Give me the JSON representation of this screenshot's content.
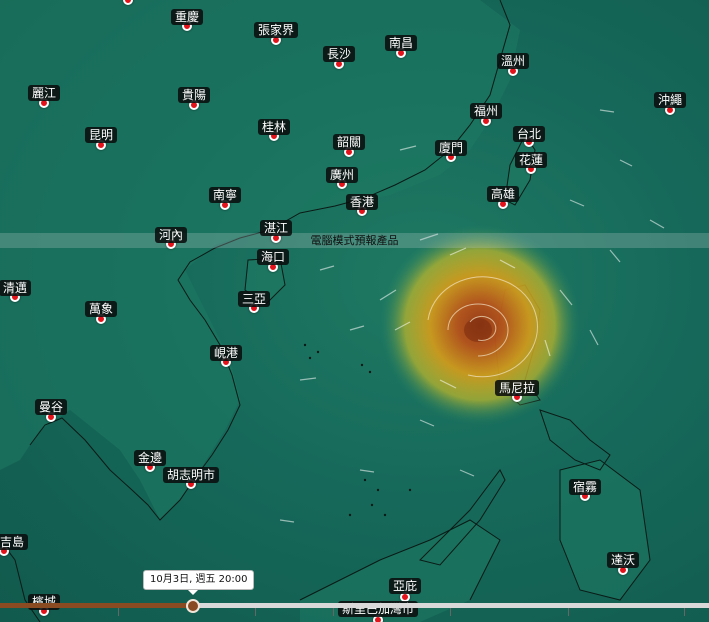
{
  "banner": "電腦模式預報產品",
  "timeline": {
    "time_label": "10月3日, 週五 20:00",
    "progress": 0.27
  },
  "colors": {
    "sea": "#16695a",
    "storm_core": "#b34a1a",
    "storm_outer": "#d6a51a",
    "marker": "#e3131b"
  },
  "cities": [
    {
      "id": "top-left",
      "name": ""
    },
    {
      "id": "chongqing",
      "name": "重慶"
    },
    {
      "id": "zhangjiajie",
      "name": "張家界"
    },
    {
      "id": "changsha",
      "name": "長沙"
    },
    {
      "id": "nanchang",
      "name": "南昌"
    },
    {
      "id": "wenzhou",
      "name": "溫州"
    },
    {
      "id": "lijiang",
      "name": "麗江"
    },
    {
      "id": "guiyang",
      "name": "貴陽"
    },
    {
      "id": "okinawa",
      "name": "沖繩"
    },
    {
      "id": "fuzhou",
      "name": "福州"
    },
    {
      "id": "kunming",
      "name": "昆明"
    },
    {
      "id": "guilin",
      "name": "桂林"
    },
    {
      "id": "taipei",
      "name": "台北"
    },
    {
      "id": "shaoguan",
      "name": "韶關"
    },
    {
      "id": "xiamen",
      "name": "廈門"
    },
    {
      "id": "hualien",
      "name": "花蓮"
    },
    {
      "id": "guangzhou",
      "name": "廣州"
    },
    {
      "id": "nanning",
      "name": "南寧"
    },
    {
      "id": "hongkong",
      "name": "香港"
    },
    {
      "id": "kaohsiung",
      "name": "高雄"
    },
    {
      "id": "hanoi",
      "name": "河內"
    },
    {
      "id": "zhanjiang",
      "name": "湛江"
    },
    {
      "id": "haikou",
      "name": "海口"
    },
    {
      "id": "thanhhoa",
      "name": "清邁"
    },
    {
      "id": "sanya",
      "name": "三亞"
    },
    {
      "id": "vientiane",
      "name": "萬象"
    },
    {
      "id": "danang",
      "name": "峴港"
    },
    {
      "id": "manila",
      "name": "馬尼拉"
    },
    {
      "id": "bangkok",
      "name": "曼谷"
    },
    {
      "id": "phnompenh",
      "name": "金邊"
    },
    {
      "id": "hcmc",
      "name": "胡志明市"
    },
    {
      "id": "cebu",
      "name": "宿霧"
    },
    {
      "id": "phuket",
      "name": "/布吉島"
    },
    {
      "id": "davao",
      "name": "達沃"
    },
    {
      "id": "kualalumpur",
      "name": "檳城"
    },
    {
      "id": "yaozhuang",
      "name": "亞庇"
    },
    {
      "id": "brunei",
      "name": "斯里巴加灣市"
    }
  ]
}
